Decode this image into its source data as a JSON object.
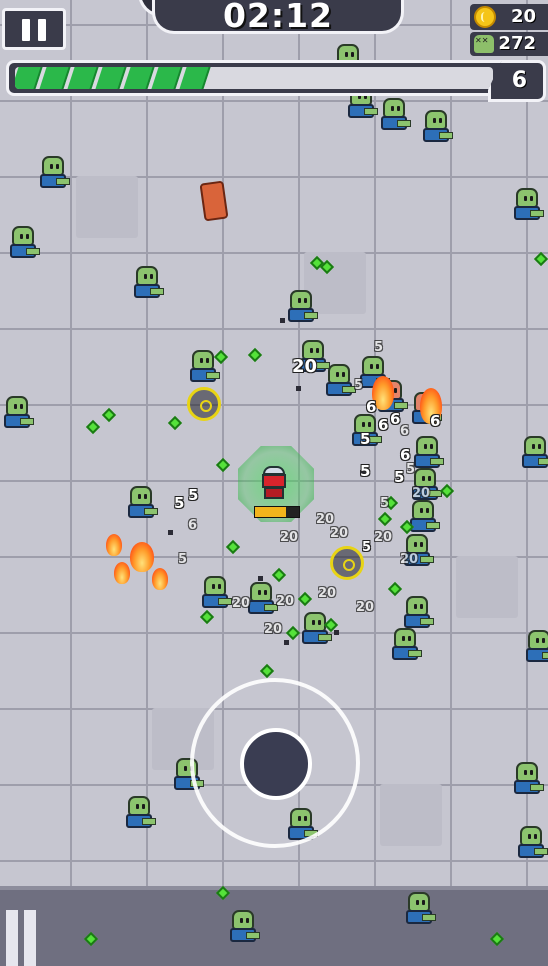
{
  "hud": {
    "timer": "02:12",
    "coins": "20",
    "kills": "272",
    "level": "6",
    "xp_progress": 0.36,
    "xp_segments": 7
  },
  "player": {
    "hp_fraction": 0.7
  },
  "damage_numbers": {
    "a": "20",
    "b": "5",
    "c": "5",
    "d": "6",
    "e": "6",
    "f": "6",
    "g": "6",
    "h": "6",
    "i": "5",
    "j": "5",
    "k": "5",
    "l": "5",
    "m": "6",
    "n": "5",
    "o": "5",
    "p": "20",
    "q": "20",
    "r": "20",
    "s": "20",
    "t": "20",
    "u": "20",
    "v": "20",
    "w": "20",
    "x": "20",
    "y": "5",
    "z": "6",
    "aa": "20",
    "ab": "5",
    "ac": "5",
    "ad": "20"
  },
  "colors": {
    "xp": "#2bb84a",
    "coin": "#f5c518",
    "hud_bg": "#3a3b4a",
    "zombie_skin": "#8cc46e",
    "zombie_shirt": "#2d6fb8",
    "player": "#d8242c"
  },
  "icons": {
    "pause": "pause-icon",
    "coin": "coin-icon",
    "kills": "skull-icon"
  }
}
